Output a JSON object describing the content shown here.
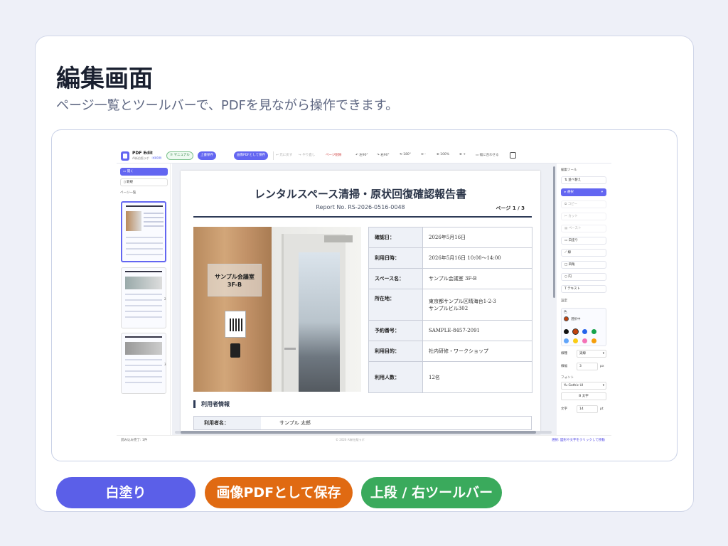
{
  "header": {
    "title": "編集画面",
    "subtitle": "ページ一覧とツールバーで、PDFを見ながら操作できます。"
  },
  "app": {
    "name": "PDF Edit",
    "subname": "AI新伯版ラボ",
    "version": "v1.0.0",
    "toolbar": {
      "manual": "⑦ マニュアル",
      "save": "上書保存",
      "save_image_pdf": "画像PDFとして保存",
      "undo": "↩ 元に戻す",
      "redo": "↪ やり直し",
      "delete_page": "ページ削除",
      "rotate_left": "↶ 左90°",
      "rotate_right": "↷ 右90°",
      "rotate_180": "⟲ 180°",
      "zoom_out": "⊖ -",
      "zoom_100": "⊕ 100%",
      "zoom_in": "⊕ +",
      "fit_width": "▭ 幅に合わせる"
    },
    "left": {
      "open": "開く",
      "new": "新規",
      "page_list": "ページ一覧",
      "page_numbers": [
        "1",
        "2",
        "3"
      ]
    },
    "document": {
      "title": "レンタルスペース清掃・原状回復確認報告書",
      "report_no": "Report No. RS-2026-0516-0048",
      "page": "ページ 1 / 3",
      "sign_line1": "サンプル会議室",
      "sign_line2": "3F-B",
      "info": [
        {
          "k": "確認日：",
          "v": "2026年5月16日"
        },
        {
          "k": "利用日時：",
          "v": "2026年5月16日 10:00〜14:00"
        },
        {
          "k": "スペース名：",
          "v": "サンプル会議室 3F-B"
        },
        {
          "k": "所在地：",
          "v": "東京都サンプル区晴海台1-2-3",
          "v2": "サンプルビル302"
        },
        {
          "k": "予約番号：",
          "v": "SAMPLE-8457-2091"
        },
        {
          "k": "利用目的：",
          "v": "社内研修・ワークショップ"
        },
        {
          "k": "利用人数：",
          "v": "12名"
        }
      ],
      "section_title": "利用者情報",
      "user_key": "利用者名：",
      "user_value": "サンプル 太郎"
    },
    "right": {
      "edit_tools": "編集ツール",
      "reorder": "並べ替え",
      "select": "選択",
      "copy": "コピー",
      "cut": "カット",
      "paste": "ペースト",
      "whiteout": "白塗り",
      "line": "線",
      "rect": "四角",
      "circle": "円",
      "text": "テキスト",
      "settings": "設定",
      "color": "色",
      "selected": "選択中",
      "line_type_label": "線種",
      "line_type": "実線",
      "line_width_label": "線幅",
      "line_width": "3",
      "px": "px",
      "font_label": "フォント",
      "font": "Yu Gothic UI",
      "bold": "B 太字",
      "text_size_label": "文字",
      "text_size": "14",
      "pt": "pt",
      "colors": [
        "#111111",
        "#c2410c",
        "#2563eb",
        "#16a34a",
        "#60a5fa",
        "#facc15",
        "#f472b6",
        "#f59e0b"
      ]
    },
    "status": {
      "left": "読み込み完了: 1件",
      "center": "© 2026 AI新伯版ラボ",
      "right": "選択: 図形や文字をクリックして移動"
    }
  },
  "buttons": {
    "whiteout": "白塗り",
    "image_pdf": "画像PDFとして保存",
    "toolbars": "上段 / 右ツールバー"
  }
}
